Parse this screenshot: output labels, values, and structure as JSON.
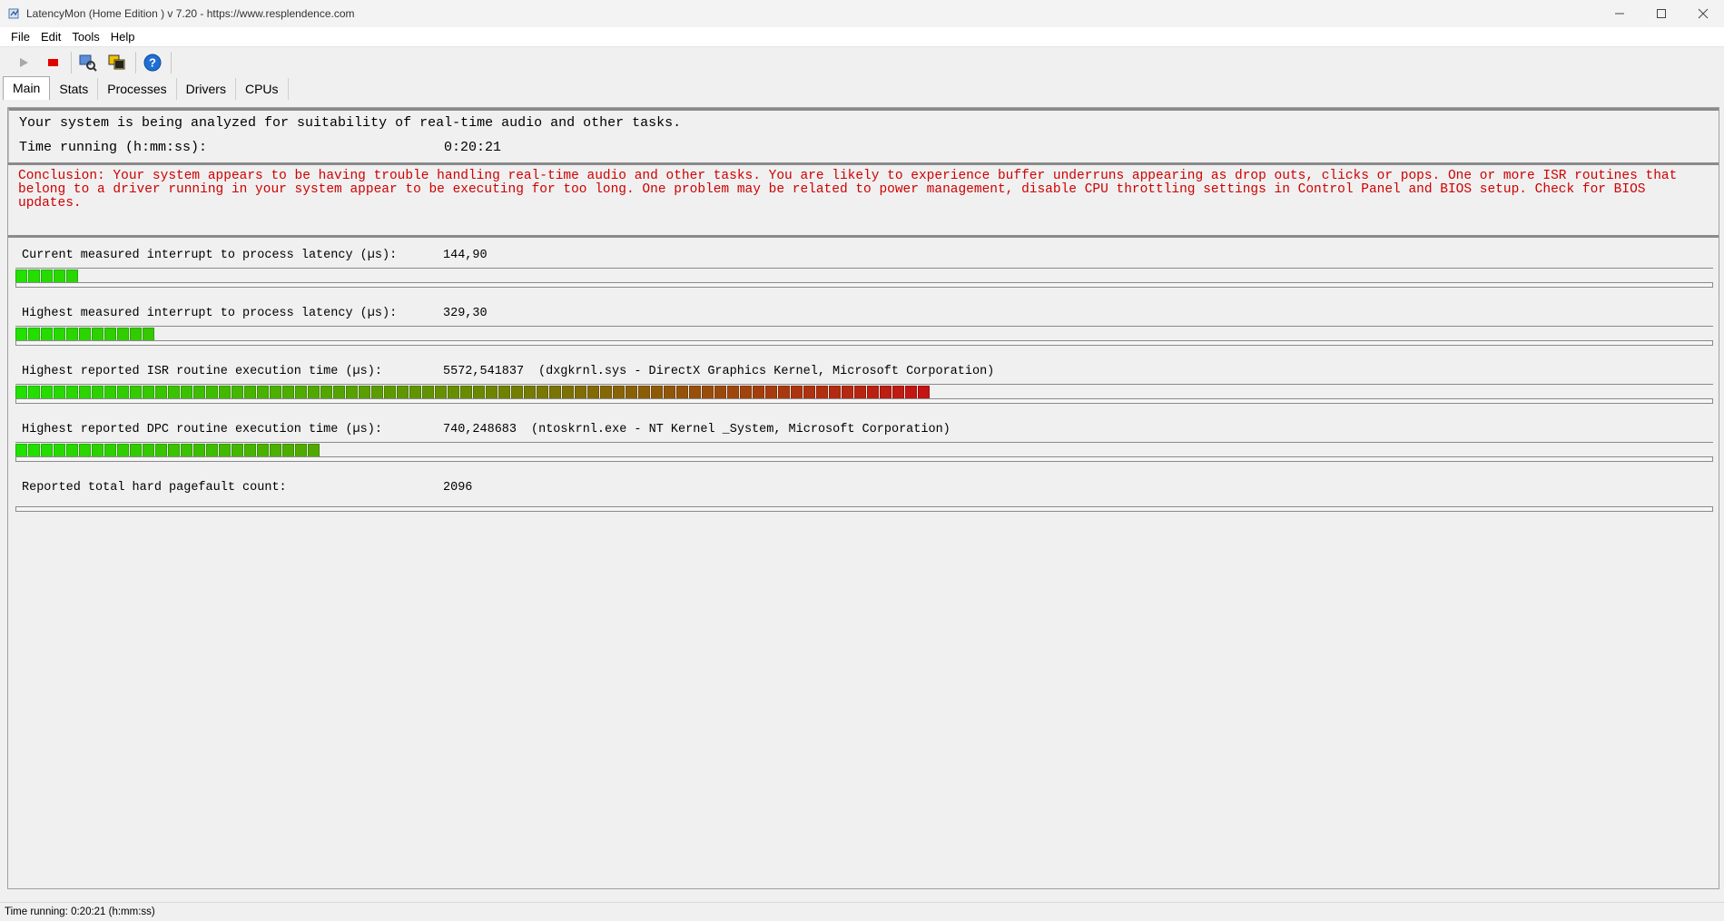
{
  "window": {
    "title": "LatencyMon  (Home Edition )  v 7.20 - https://www.resplendence.com",
    "icons": {
      "app": "latencymon-icon",
      "minimize": "minimize-icon",
      "maximize": "maximize-icon",
      "close": "close-icon"
    }
  },
  "menu": {
    "items": [
      "File",
      "Edit",
      "Tools",
      "Help"
    ]
  },
  "toolbar": {
    "buttons": [
      "play-icon",
      "stop-icon",
      "analyze-icon",
      "windows-icon",
      "help-icon"
    ],
    "colors": {
      "stop": "#e00000",
      "help": "#1e6fd1"
    }
  },
  "tabs": [
    "Main",
    "Stats",
    "Processes",
    "Drivers",
    "CPUs"
  ],
  "analysis": {
    "status": "Your system is being analyzed for suitability of real-time audio and other tasks.",
    "time_label": "Time running (h:mm:ss):",
    "time_value": "0:20:21"
  },
  "conclusion": {
    "text": "Conclusion: Your system appears to be having trouble handling real-time audio and other tasks. You are likely to experience buffer underruns appearing as drop outs, clicks or pops. One or more ISR routines that belong to a driver running in your system appear to be executing for too long. One problem may be related to power management, disable CPU throttling settings in Control Panel and BIOS setup. Check for BIOS updates.",
    "color": "#d00000"
  },
  "metrics": [
    {
      "label": "Current measured interrupt to process latency (µs):",
      "value": "144,90",
      "extra": "",
      "segments": 5
    },
    {
      "label": "Highest measured interrupt to process latency (µs):",
      "value": "329,30",
      "extra": "",
      "segments": 11
    },
    {
      "label": "Highest reported ISR routine execution time (µs):",
      "value": "5572,541837",
      "extra": "(dxgkrnl.sys - DirectX Graphics Kernel, Microsoft Corporation)",
      "segments": 72
    },
    {
      "label": "Highest reported DPC routine execution time (µs):",
      "value": "740,248683",
      "extra": "(ntoskrnl.exe - NT Kernel _System, Microsoft Corporation)",
      "segments": 24
    },
    {
      "label": "Reported total hard pagefault count:",
      "value": "2096",
      "extra": "",
      "segments": 0
    }
  ],
  "bar_colors": {
    "start": "#22e000",
    "mid": "#6a8a00",
    "end": "#c41414"
  },
  "statusbar": {
    "text": "Time running: 0:20:21  (h:mm:ss)"
  }
}
